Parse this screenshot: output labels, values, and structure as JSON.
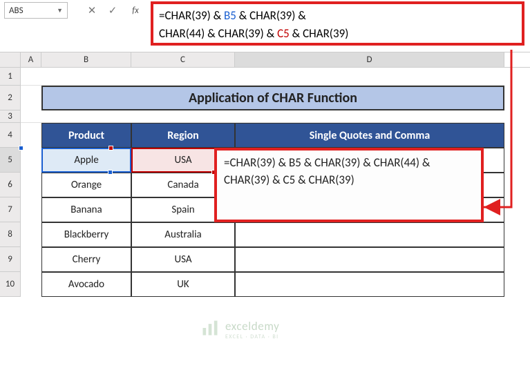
{
  "name_box": "ABS",
  "formula_line1_a": "=CHAR(39) & ",
  "formula_line1_ref": "B5",
  "formula_line1_b": " & CHAR(39) &",
  "formula_line2_a": "CHAR(44) & CHAR(39) & ",
  "formula_line2_ref": "C5",
  "formula_line2_b": " & CHAR(39)",
  "icons": {
    "drop": "▼",
    "cancel": "✕",
    "enter": "✓",
    "fx": "fx"
  },
  "columns": {
    "A": "A",
    "B": "B",
    "C": "C",
    "D": "D"
  },
  "rows": [
    "1",
    "2",
    "3",
    "4",
    "5",
    "6",
    "7",
    "8",
    "9",
    "10"
  ],
  "title": "Application of CHAR Function",
  "headers": {
    "product": "Product",
    "region": "Region",
    "sq": "Single Quotes and Comma"
  },
  "data": [
    {
      "product": "Apple",
      "region": "USA"
    },
    {
      "product": "Orange",
      "region": "Canada"
    },
    {
      "product": "Banana",
      "region": "Spain"
    },
    {
      "product": "Blackberry",
      "region": "Australia"
    },
    {
      "product": "Cherry",
      "region": "USA"
    },
    {
      "product": "Avocado",
      "region": "UK"
    }
  ],
  "edit_text": "=CHAR(39) & B5 & CHAR(39) & CHAR(44) & CHAR(39) & C5 & CHAR(39)",
  "watermark": {
    "name": "exceldemy",
    "tag": "EXCEL · DATA · BI"
  }
}
